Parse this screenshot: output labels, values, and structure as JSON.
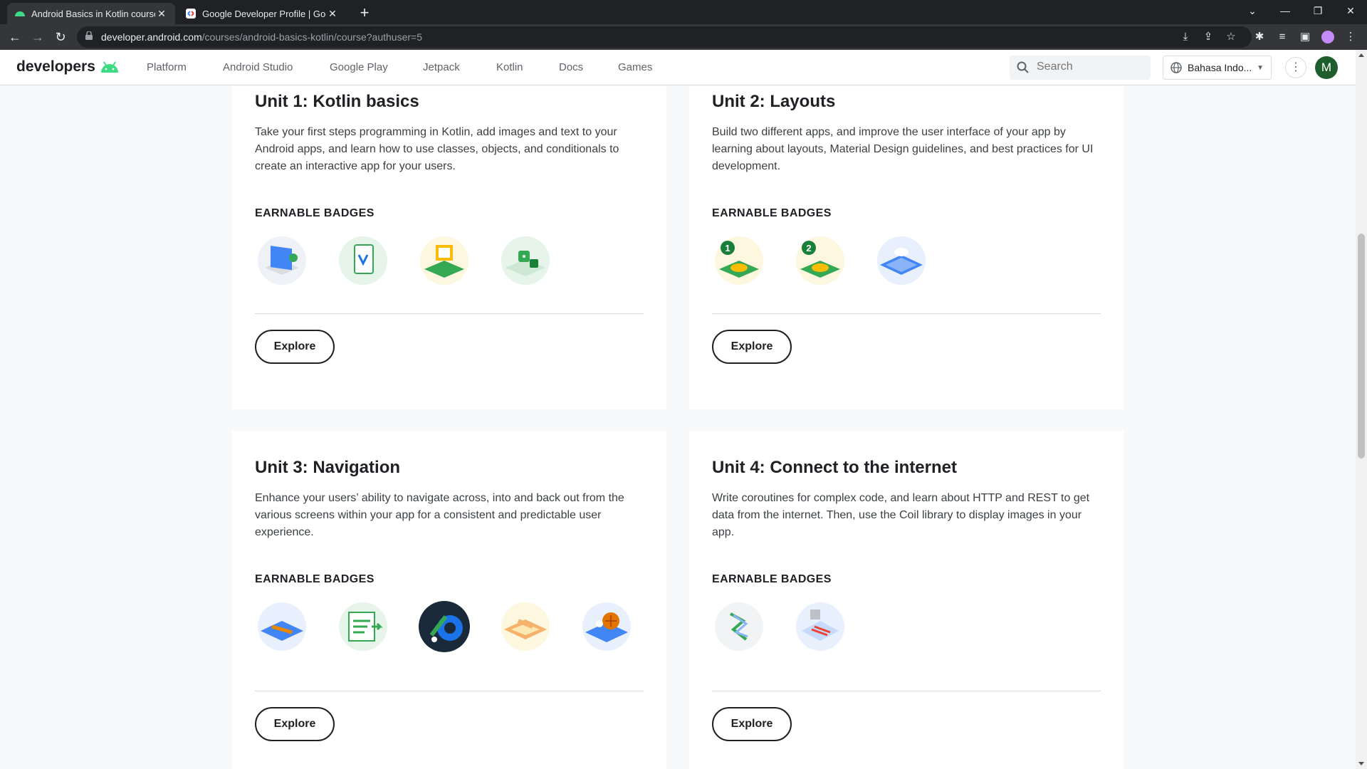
{
  "browser": {
    "tabs": [
      {
        "title": "Android Basics in Kotlin course |",
        "active": true
      },
      {
        "title": "Google Developer Profile | Goo",
        "active": false
      }
    ],
    "url_host": "developer.android.com",
    "url_path": "/courses/android-basics-kotlin/course?authuser=5"
  },
  "site": {
    "logo_text": "developers",
    "nav": [
      "Platform",
      "Android Studio",
      "Google Play",
      "Jetpack",
      "Kotlin",
      "Docs",
      "Games"
    ],
    "search_placeholder": "Search",
    "language": "Bahasa Indo...",
    "avatar_initial": "M"
  },
  "units": [
    {
      "title": "Unit 1: Kotlin basics",
      "description": "Take your first steps programming in Kotlin, add images and text to your Android apps, and learn how to use classes, objects, and conditionals to create an interactive app for your users.",
      "badges_label": "EARNABLE BADGES",
      "badge_count": 4,
      "explore_label": "Explore"
    },
    {
      "title": "Unit 2: Layouts",
      "description": "Build two different apps, and improve the user interface of your app by learning about layouts, Material Design guidelines, and best practices for UI development.",
      "badges_label": "EARNABLE BADGES",
      "badge_count": 3,
      "badge_numbers": [
        "1",
        "2"
      ],
      "explore_label": "Explore"
    },
    {
      "title": "Unit 3: Navigation",
      "description": "Enhance your users’ ability to navigate across, into and back out from the various screens within your app for a consistent and predictable user experience.",
      "badges_label": "EARNABLE BADGES",
      "badge_count": 5,
      "explore_label": "Explore"
    },
    {
      "title": "Unit 4: Connect to the internet",
      "description": "Write coroutines for complex code, and learn about HTTP and REST to get data from the internet. Then, use the Coil library to display images in your app.",
      "badges_label": "EARNABLE BADGES",
      "badge_count": 2,
      "explore_label": "Explore"
    }
  ],
  "colors": {
    "android_green": "#3ddc84",
    "badge_green": "#34a853",
    "badge_blue": "#4285f4",
    "badge_orange": "#f6b26b",
    "text_primary": "#202124"
  }
}
